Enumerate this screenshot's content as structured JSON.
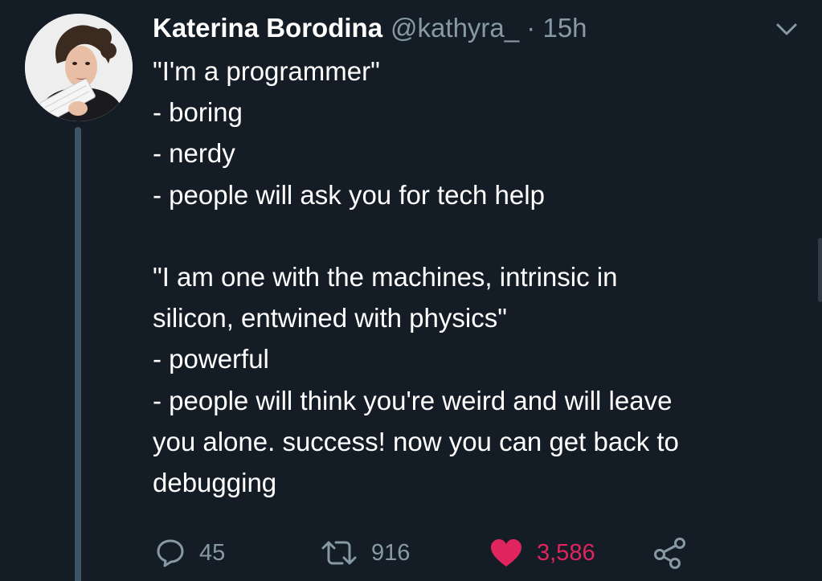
{
  "tweet": {
    "author": {
      "display_name": "Katerina Borodina",
      "handle": "@kathyra_",
      "separator": "·",
      "time": "15h"
    },
    "menu_icon": "chevron-down-icon",
    "text_lines": [
      "\"I'm a programmer\"",
      "- boring",
      "- nerdy",
      "- people will ask you for tech help",
      "",
      "\"I am one with the machines, intrinsic in",
      "silicon, entwined with physics\"",
      "- powerful",
      "- people will think you're weird and will leave",
      "you alone. success! now you can get back to",
      "debugging"
    ],
    "actions": {
      "reply": {
        "icon": "reply-icon",
        "count": "45"
      },
      "retweet": {
        "icon": "retweet-icon",
        "count": "916"
      },
      "like": {
        "icon": "heart-icon",
        "count": "3,586",
        "liked": true
      },
      "share": {
        "icon": "share-icon"
      }
    }
  },
  "colors": {
    "background": "#141d26",
    "text": "#ffffff",
    "secondary": "#8899a6",
    "like": "#e0245e",
    "thread_line": "#3d5466"
  }
}
